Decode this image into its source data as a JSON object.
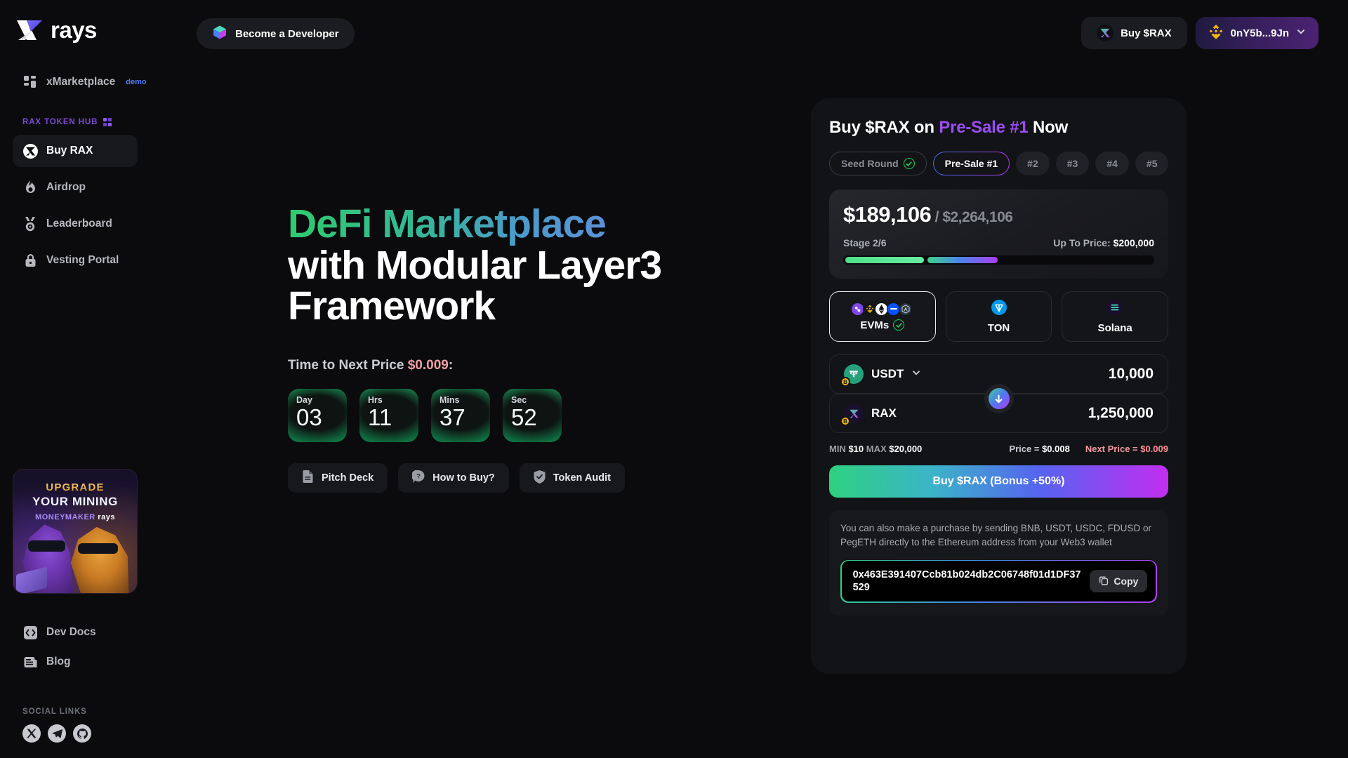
{
  "brand": {
    "name": "rays",
    "logo_icon": "rays-x-logo"
  },
  "sidebar": {
    "top_items": [
      {
        "label": "xMarketplace",
        "badge": "demo",
        "icon": "grid-icon"
      }
    ],
    "hub_label": "RAX TOKEN HUB",
    "hub_items": [
      {
        "label": "Buy RAX",
        "icon": "rax-x-icon",
        "active": true
      },
      {
        "label": "Airdrop",
        "icon": "flame-icon",
        "active": false
      },
      {
        "label": "Leaderboard",
        "icon": "medal-icon",
        "active": false
      },
      {
        "label": "Vesting Portal",
        "icon": "lock-icon",
        "active": false
      }
    ],
    "promo": {
      "line1": "UPGRADE",
      "line2": "YOUR MINING",
      "line3_brand": "MONEYMAKER",
      "line3_rays": "rays"
    },
    "bottom_items": [
      {
        "label": "Dev Docs",
        "icon": "code-brackets-icon"
      },
      {
        "label": "Blog",
        "icon": "article-icon"
      }
    ],
    "social_label": "SOCIAL LINKS",
    "socials": [
      {
        "name": "x-twitter-icon"
      },
      {
        "name": "telegram-icon"
      },
      {
        "name": "github-icon"
      }
    ]
  },
  "topbar": {
    "become_developer": "Become a Developer",
    "become_developer_icon": "cube-icon",
    "buy_rax": "Buy $RAX",
    "buy_rax_icon": "rax-x-icon",
    "wallet": "0nY5b...9Jn",
    "wallet_icon": "bnb-icon",
    "wallet_chevron": "chevron-down-icon"
  },
  "hero": {
    "title_gradient": "DeFi Marketplace",
    "title_rest": "with Modular Layer3 Framework",
    "next_price_label": "Time to Next Price ",
    "next_price_value": "$0.009",
    "next_price_colon": ":",
    "countdown": [
      {
        "label": "Day",
        "value": "03"
      },
      {
        "label": "Hrs",
        "value": "11"
      },
      {
        "label": "Mins",
        "value": "37"
      },
      {
        "label": "Sec",
        "value": "52"
      }
    ],
    "actions": [
      {
        "label": "Pitch Deck",
        "icon": "document-icon"
      },
      {
        "label": "How to Buy?",
        "icon": "question-bubble-icon"
      },
      {
        "label": "Token Audit",
        "icon": "shield-check-icon"
      }
    ]
  },
  "panel": {
    "title_pre": "Buy $RAX on ",
    "title_stage": "Pre-Sale #1",
    "title_post": " Now",
    "stages": [
      {
        "label": "Seed Round",
        "state": "completed",
        "icon": "check-circle-icon"
      },
      {
        "label": "Pre-Sale #1",
        "state": "current"
      },
      {
        "label": "#2",
        "state": "upcoming"
      },
      {
        "label": "#3",
        "state": "upcoming"
      },
      {
        "label": "#4",
        "state": "upcoming"
      },
      {
        "label": "#5",
        "state": "upcoming"
      }
    ],
    "raised": {
      "current": "$189,106",
      "separator": " / ",
      "total": "$2,264,106",
      "stage_label": "Stage 2/6",
      "up_to_price_label": "Up To Price: ",
      "up_to_price_value": "$200,000",
      "progress_segment_1_pct": 27,
      "progress_segment_2_pct": 24
    },
    "chains": [
      {
        "label": "EVMs",
        "selected": true,
        "check_icon": "check-circle-icon",
        "icons": [
          "polygon-icon",
          "bnb-icon",
          "ethereum-icon",
          "base-icon",
          "arbitrum-icon"
        ]
      },
      {
        "label": "TON",
        "selected": false,
        "icons": [
          "ton-icon"
        ]
      },
      {
        "label": "Solana",
        "selected": false,
        "icons": [
          "solana-icon"
        ]
      }
    ],
    "swap": {
      "from_token": "USDT",
      "from_token_icon": "usdt-icon",
      "from_chain_badge": "bnb-icon",
      "from_chevron": "chevron-down-icon",
      "from_amount": "10,000",
      "swap_icon": "arrow-down-icon",
      "to_token": "RAX",
      "to_token_icon": "rax-x-icon",
      "to_chain_badge": "bnb-icon",
      "to_amount": "1,250,000"
    },
    "limits": {
      "min_label": "MIN ",
      "min_value": "$10",
      "max_label": " MAX ",
      "max_value": "$20,000",
      "price_label": "Price = ",
      "price_value": "$0.008",
      "next_price_label": "Next Price = ",
      "next_price_value": "$0.009"
    },
    "buy_button": "Buy $RAX (Bonus +50%)",
    "note_text": "You can also make a purchase by sending BNB, USDT, USDC, FDUSD or PegETH directly to the Ethereum address from your Web3 wallet",
    "address": "0x463E391407Ccb81b024db2C06748f01d1DF37529",
    "copy_label": "Copy",
    "copy_icon": "copy-icon"
  },
  "colors": {
    "background": "#0b0b0d",
    "panel": "#121316",
    "accent_purple": "#9b4df5",
    "accent_green": "#2fcb6e",
    "accent_blue": "#4f7dfb",
    "danger_pink": "#ff8d96"
  }
}
